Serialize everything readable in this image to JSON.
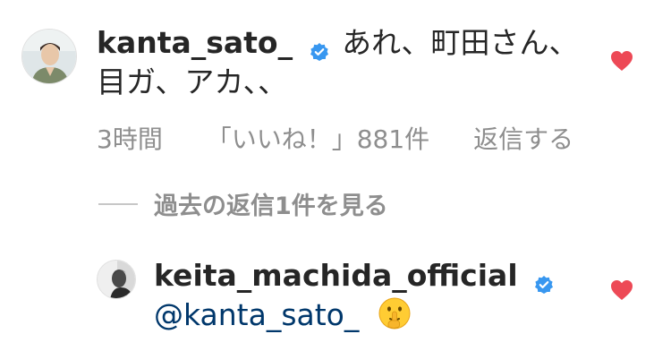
{
  "comments": [
    {
      "username": "kanta_sato_",
      "text_line1": "あれ、町田さん、",
      "text_line2": "目ガ、アカ、、",
      "time": "3時間",
      "likes": "「いいね！」881件",
      "reply": "返信する"
    },
    {
      "username": "keita_machida_official",
      "mention": "@kanta_sato_"
    }
  ],
  "view_replies": "過去の返信1件を見る",
  "colors": {
    "heart": "#ed4956",
    "verified": "#3897f0",
    "meta": "#8e8e8e",
    "mention": "#00376b"
  }
}
